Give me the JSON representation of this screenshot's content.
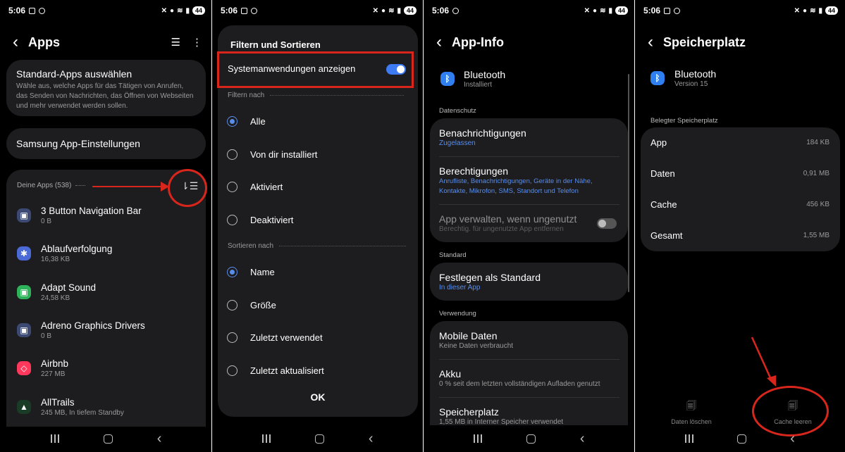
{
  "status": {
    "p1_time": "5:06",
    "p2_time": "5:06",
    "p3_time": "5:06",
    "p4_time": "5:06",
    "battery": "44"
  },
  "colors": {
    "accent": "#5a8de8",
    "annotation_red": "#d9261c",
    "card_bg": "#1d1d1f"
  },
  "apps_screen": {
    "title": "Apps",
    "default_apps_title": "Standard-Apps auswählen",
    "default_apps_desc": "Wähle aus, welche Apps für das Tätigen von Anrufen, das Senden von Nachrichten, das Öffnen von Webseiten und mehr verwendet werden sollen.",
    "samsung_settings": "Samsung App-Einstellungen",
    "your_apps_label": "Deine Apps (538)",
    "apps": [
      {
        "name": "3 Button Navigation Bar",
        "size": "0 B",
        "icon": "android-icon",
        "color": "#3c4a73"
      },
      {
        "name": "Ablaufverfolgung",
        "size": "16,38 KB",
        "icon": "gear-icon",
        "color": "#4b6ad6"
      },
      {
        "name": "Adapt Sound",
        "size": "24,58 KB",
        "icon": "android-icon",
        "color": "#2fb35a"
      },
      {
        "name": "Adreno Graphics Drivers",
        "size": "0 B",
        "icon": "android-icon",
        "color": "#3c4a73"
      },
      {
        "name": "Airbnb",
        "size": "227 MB",
        "icon": "airbnb-icon",
        "color": "#ff385c"
      },
      {
        "name": "AllTrails",
        "size": "245 MB, In tiefem Standby",
        "icon": "alltrails-icon",
        "color": "#1a3b26"
      }
    ]
  },
  "filter_sheet": {
    "title": "Filtern und Sortieren",
    "system_apps_label": "Systemanwendungen anzeigen",
    "filter_label": "Filtern nach",
    "filters": [
      "Alle",
      "Von dir installiert",
      "Aktiviert",
      "Deaktiviert"
    ],
    "sort_label": "Sortieren nach",
    "sorts": [
      "Name",
      "Größe",
      "Zuletzt verwendet",
      "Zuletzt aktualisiert"
    ],
    "ok": "OK"
  },
  "app_info": {
    "title": "App-Info",
    "app_name": "Bluetooth",
    "app_status": "Installiert",
    "privacy_label": "Datenschutz",
    "notifications": "Benachrichtigungen",
    "notifications_sub": "Zugelassen",
    "permissions": "Berechtigungen",
    "permissions_sub": "Anrufliste, Benachrichtigungen, Geräte in der Nähe, Kontakte, Mikrofon, SMS, Standort und Telefon",
    "manage_unused": "App verwalten, wenn ungenutzt",
    "manage_unused_sub": "Berechtig. für ungenutzte App entfernen",
    "standard_label": "Standard",
    "set_default": "Festlegen als Standard",
    "set_default_sub": "In dieser App",
    "usage_label": "Verwendung",
    "mobile_data": "Mobile Daten",
    "mobile_data_sub": "Keine Daten verbraucht",
    "battery": "Akku",
    "battery_sub": "0 % seit dem letzten vollständigen Aufladen genutzt",
    "storage": "Speicherplatz",
    "storage_sub": "1,55 MB in Interner Speicher verwendet"
  },
  "storage_screen": {
    "title": "Speicherplatz",
    "app_name": "Bluetooth",
    "version": "Version 15",
    "used_label": "Belegter Speicherplatz",
    "rows": [
      {
        "key": "App",
        "value": "184 KB"
      },
      {
        "key": "Daten",
        "value": "0,91 MB"
      },
      {
        "key": "Cache",
        "value": "456 KB"
      },
      {
        "key": "Gesamt",
        "value": "1,55 MB"
      }
    ],
    "clear_data": "Daten löschen",
    "clear_cache": "Cache leeren"
  }
}
